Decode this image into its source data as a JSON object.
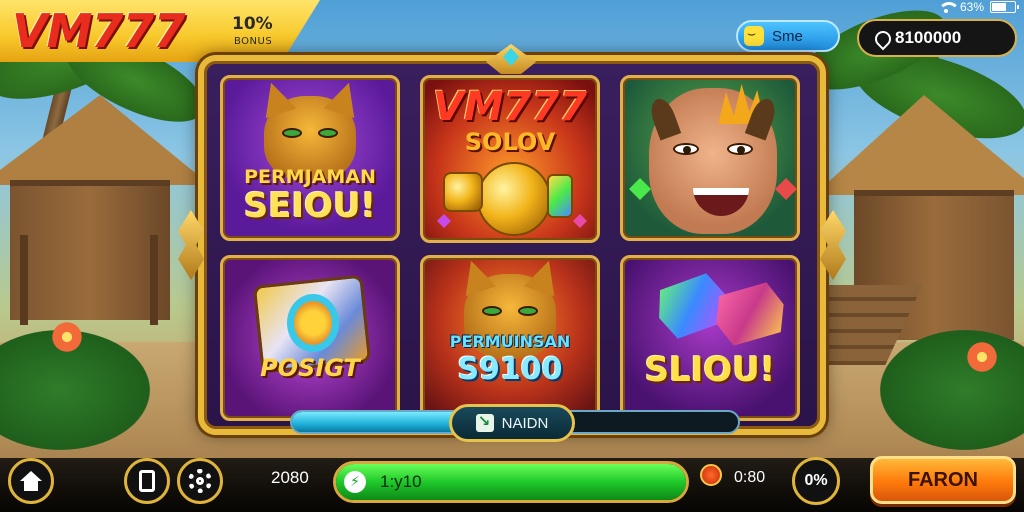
{
  "header": {
    "logo": "VM777",
    "promo_value": "10%",
    "promo_caption": "BONUS"
  },
  "status_bar": {
    "battery_percent": "63%",
    "wifi_icon": "wifi-icon",
    "battery_icon": "battery-icon"
  },
  "user_pill": {
    "label": "Sme",
    "icon": "smile-icon"
  },
  "coins_pill": {
    "value": "8100000",
    "icon": "pin-icon"
  },
  "tiles": [
    {
      "line1": "PERMJAMAN",
      "line2": "SEIOU!"
    },
    {
      "line1": "VM777",
      "line2": "SOLOV"
    },
    {
      "line1": "",
      "line2": ""
    },
    {
      "line1": "POSIGT",
      "line2": ""
    },
    {
      "line1": "PERMUINSAN",
      "line2": "S9100"
    },
    {
      "line1": "SLIOU!",
      "line2": ""
    }
  ],
  "progress_strip": {
    "button_label": "NAIDN",
    "fill_percent": 36
  },
  "bottom_bar": {
    "home_icon": "home-icon",
    "phone_icon": "phone-icon",
    "gear_icon": "gear-icon",
    "balance_left": "2080",
    "green_bar_label": "1:y10",
    "green_fill_percent": 100,
    "balance_right": "0:80",
    "percent_label": "0%",
    "cta_label": "FARON"
  },
  "colors": {
    "gold": "#e9b93a",
    "logo_red": "#e82d1f",
    "cta_orange": "#ff7a0a",
    "bar_green": "#1ec82a",
    "strip_cyan": "#1eb0d8"
  }
}
